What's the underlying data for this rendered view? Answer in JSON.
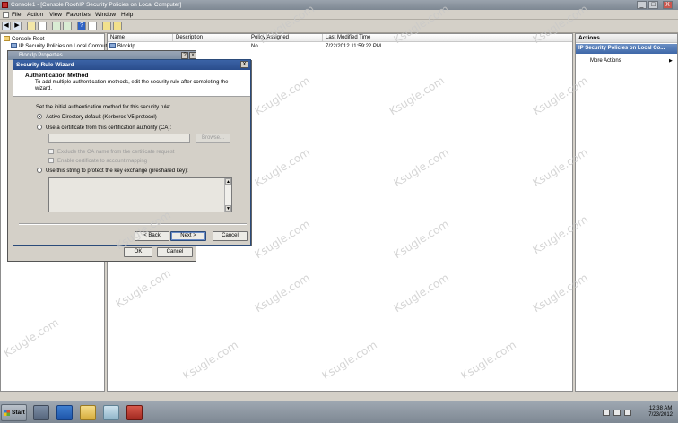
{
  "window": {
    "title": "Console1 - [Console Root\\IP Security Policies on Local Computer]",
    "controls": [
      "_",
      "□",
      "X"
    ]
  },
  "menu": [
    "File",
    "Action",
    "View",
    "Favorites",
    "Window",
    "Help"
  ],
  "tree": {
    "root": "Console Root",
    "child": "IP Security Policies on Local Compute"
  },
  "list": {
    "columns": [
      "Name",
      "Description",
      "Policy Assigned",
      "Last Modified Time"
    ],
    "rows": [
      {
        "name": "BlockIp",
        "description": "",
        "assigned": "No",
        "modified": "7/22/2012 11:59:22 PM"
      }
    ]
  },
  "actions": {
    "header": "Actions",
    "selected": "IP Security Policies on Local Co...",
    "more": "More Actions"
  },
  "properties_window": {
    "title": "BlockIp Properties",
    "ok": "OK",
    "cancel": "Cancel"
  },
  "wizard": {
    "title": "Security Rule Wizard",
    "header_title": "Authentication Method",
    "header_desc": "To add multiple authentication methods, edit the security rule after completing the wizard.",
    "prompt": "Set the initial authentication method for this security rule:",
    "option_ad": "Active Directory default (Kerberos V5 protocol)",
    "option_cert": "Use a certificate from this certification authority (CA):",
    "browse": "Browse...",
    "chk_ca_name": "Exclude the CA name from the certificate request",
    "chk_mapping": "Enable certificate to account mapping",
    "option_psk": "Use this string to protect the key exchange (preshared key):",
    "back": "< Back",
    "next": "Next >",
    "cancel": "Cancel"
  },
  "taskbar": {
    "start": "Start",
    "time": "12:38 AM",
    "date": "7/23/2012"
  },
  "watermark": "Ksugle.com"
}
